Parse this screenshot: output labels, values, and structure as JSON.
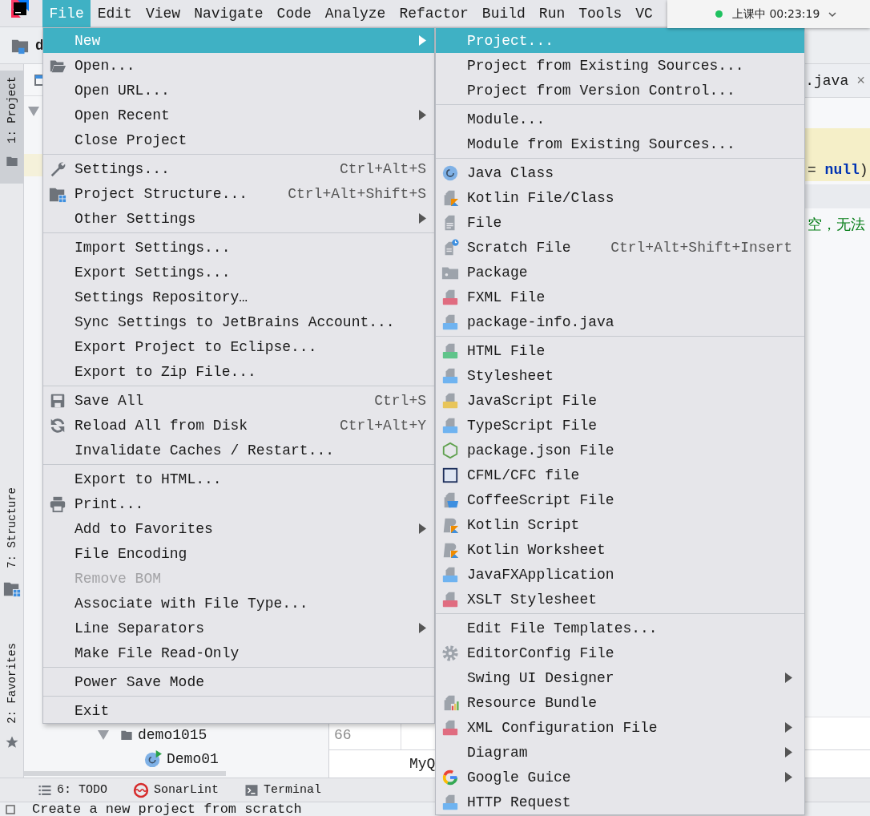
{
  "menubar": {
    "items": [
      {
        "label": "File",
        "selected": true
      },
      {
        "label": "Edit",
        "selected": false
      },
      {
        "label": "View",
        "selected": false
      },
      {
        "label": "Navigate",
        "selected": false
      },
      {
        "label": "Code",
        "selected": false
      },
      {
        "label": "Analyze",
        "selected": false
      },
      {
        "label": "Refactor",
        "selected": false
      },
      {
        "label": "Build",
        "selected": false
      },
      {
        "label": "Run",
        "selected": false
      },
      {
        "label": "Tools",
        "selected": false
      },
      {
        "label": "VC",
        "selected": false
      }
    ]
  },
  "session_timer": {
    "text": "上课中 00:23:19"
  },
  "toolbar": {
    "project_name": "d"
  },
  "tool_strip": {
    "tabs": [
      {
        "label": "1: Project",
        "kind": "folder",
        "selected": true
      },
      {
        "label": "7: Structure",
        "kind": "structure",
        "selected": false
      },
      {
        "label": "2: Favorites",
        "kind": "star",
        "selected": false
      }
    ]
  },
  "project_tree": {
    "rows": [
      {
        "label": "demo1015",
        "kind": "folder",
        "expanded": true,
        "children": [
          {
            "label": "Demo01",
            "kind": "runnable"
          }
        ]
      }
    ]
  },
  "editor": {
    "tab": {
      "label": ".java",
      "close": "×"
    },
    "code_lines": [
      {
        "text": "= **null**)",
        "kind": "code",
        "highlighted": true
      },
      {
        "text": "空，无法",
        "kind": "string",
        "highlighted": false
      }
    ],
    "gutter_number": "66",
    "bottom_panel": "MyQ"
  },
  "file_menu": {
    "sections": [
      [
        {
          "label": "New",
          "kind": "plain",
          "has_submenu": true,
          "selected": true,
          "disabled": false
        },
        {
          "label": "Open...",
          "kind": "open",
          "has_submenu": false,
          "selected": false,
          "disabled": false
        },
        {
          "label": "Open URL...",
          "kind": "plain",
          "has_submenu": false,
          "selected": false,
          "disabled": false
        },
        {
          "label": "Open Recent",
          "kind": "plain",
          "has_submenu": true,
          "selected": false,
          "disabled": false
        },
        {
          "label": "Close Project",
          "kind": "plain",
          "has_submenu": false,
          "selected": false,
          "disabled": false
        }
      ],
      [
        {
          "label": "Settings...",
          "kind": "wrench",
          "shortcut": "Ctrl+Alt+S",
          "has_submenu": false,
          "selected": false,
          "disabled": false
        },
        {
          "label": "Project Structure...",
          "kind": "structure",
          "shortcut": "Ctrl+Alt+Shift+S",
          "has_submenu": false,
          "selected": false,
          "disabled": false
        },
        {
          "label": "Other Settings",
          "kind": "plain",
          "has_submenu": true,
          "selected": false,
          "disabled": false
        }
      ],
      [
        {
          "label": "Import Settings...",
          "kind": "plain",
          "has_submenu": false,
          "selected": false,
          "disabled": false
        },
        {
          "label": "Export Settings...",
          "kind": "plain",
          "has_submenu": false,
          "selected": false,
          "disabled": false
        },
        {
          "label": "Settings Repository…",
          "kind": "plain",
          "has_submenu": false,
          "selected": false,
          "disabled": false
        },
        {
          "label": "Sync Settings to JetBrains Account...",
          "kind": "plain",
          "has_submenu": false,
          "selected": false,
          "disabled": false
        },
        {
          "label": "Export Project to Eclipse...",
          "kind": "plain",
          "has_submenu": false,
          "selected": false,
          "disabled": false
        },
        {
          "label": "Export to Zip File...",
          "kind": "plain",
          "has_submenu": false,
          "selected": false,
          "disabled": false
        }
      ],
      [
        {
          "label": "Save All",
          "kind": "save",
          "shortcut": "Ctrl+S",
          "has_submenu": false,
          "selected": false,
          "disabled": false
        },
        {
          "label": "Reload All from Disk",
          "kind": "reload",
          "shortcut": "Ctrl+Alt+Y",
          "has_submenu": false,
          "selected": false,
          "disabled": false
        },
        {
          "label": "Invalidate Caches / Restart...",
          "kind": "plain",
          "has_submenu": false,
          "selected": false,
          "disabled": false
        }
      ],
      [
        {
          "label": "Export to HTML...",
          "kind": "plain",
          "has_submenu": false,
          "selected": false,
          "disabled": false
        },
        {
          "label": "Print...",
          "kind": "printer",
          "has_submenu": false,
          "selected": false,
          "disabled": false
        },
        {
          "label": "Add to Favorites",
          "kind": "plain",
          "has_submenu": true,
          "selected": false,
          "disabled": false
        },
        {
          "label": "File Encoding",
          "kind": "plain",
          "has_submenu": false,
          "selected": false,
          "disabled": false
        },
        {
          "label": "Remove BOM",
          "kind": "plain",
          "has_submenu": false,
          "selected": false,
          "disabled": true
        },
        {
          "label": "Associate with File Type...",
          "kind": "plain",
          "has_submenu": false,
          "selected": false,
          "disabled": false
        },
        {
          "label": "Line Separators",
          "kind": "plain",
          "has_submenu": true,
          "selected": false,
          "disabled": false
        },
        {
          "label": "Make File Read-Only",
          "kind": "plain",
          "has_submenu": false,
          "selected": false,
          "disabled": false
        }
      ],
      [
        {
          "label": "Power Save Mode",
          "kind": "plain",
          "has_submenu": false,
          "selected": false,
          "disabled": false
        }
      ],
      [
        {
          "label": "Exit",
          "kind": "plain",
          "has_submenu": false,
          "selected": false,
          "disabled": false
        }
      ]
    ]
  },
  "new_submenu": {
    "sections": [
      [
        {
          "label": "Project...",
          "kind": "plain",
          "has_submenu": false,
          "selected": true
        },
        {
          "label": "Project from Existing Sources...",
          "kind": "plain",
          "has_submenu": false,
          "selected": false
        },
        {
          "label": "Project from Version Control...",
          "kind": "plain",
          "has_submenu": false,
          "selected": false
        }
      ],
      [
        {
          "label": "Module...",
          "kind": "plain",
          "has_submenu": false,
          "selected": false
        },
        {
          "label": "Module from Existing Sources...",
          "kind": "plain",
          "has_submenu": false,
          "selected": false
        }
      ],
      [
        {
          "label": "Java Class",
          "kind": "class",
          "has_submenu": false,
          "selected": false
        },
        {
          "label": "Kotlin File/Class",
          "kind": "kotlin",
          "has_submenu": false,
          "selected": false
        },
        {
          "label": "File",
          "kind": "file",
          "has_submenu": false,
          "selected": false
        },
        {
          "label": "Scratch File",
          "kind": "scratch",
          "shortcut": "Ctrl+Alt+Shift+Insert",
          "has_submenu": false,
          "selected": false
        },
        {
          "label": "Package",
          "kind": "package",
          "has_submenu": false,
          "selected": false
        },
        {
          "label": "FXML File",
          "kind": "xml",
          "has_submenu": false,
          "selected": false
        },
        {
          "label": "package-info.java",
          "kind": "javafile",
          "has_submenu": false,
          "selected": false
        }
      ],
      [
        {
          "label": "HTML File",
          "kind": "html",
          "has_submenu": false,
          "selected": false
        },
        {
          "label": "Stylesheet",
          "kind": "css",
          "has_submenu": false,
          "selected": false
        },
        {
          "label": "JavaScript File",
          "kind": "js",
          "has_submenu": false,
          "selected": false
        },
        {
          "label": "TypeScript File",
          "kind": "ts",
          "has_submenu": false,
          "selected": false
        },
        {
          "label": "package.json File",
          "kind": "hexagon",
          "has_submenu": false,
          "selected": false
        },
        {
          "label": "CFML/CFC file",
          "kind": "square",
          "has_submenu": false,
          "selected": false
        },
        {
          "label": "CoffeeScript File",
          "kind": "cup",
          "has_submenu": false,
          "selected": false
        },
        {
          "label": "Kotlin Script",
          "kind": "script",
          "has_submenu": false,
          "selected": false
        },
        {
          "label": "Kotlin Worksheet",
          "kind": "script",
          "has_submenu": false,
          "selected": false
        },
        {
          "label": "JavaFXApplication",
          "kind": "javafile",
          "has_submenu": false,
          "selected": false
        },
        {
          "label": "XSLT Stylesheet",
          "kind": "xml",
          "has_submenu": false,
          "selected": false
        }
      ],
      [
        {
          "label": "Edit File Templates...",
          "kind": "plain",
          "has_submenu": false,
          "selected": false
        },
        {
          "label": "EditorConfig File",
          "kind": "gear",
          "has_submenu": false,
          "selected": false
        },
        {
          "label": "Swing UI Designer",
          "kind": "plain",
          "has_submenu": true,
          "selected": false
        },
        {
          "label": "Resource Bundle",
          "kind": "bundle",
          "has_submenu": false,
          "selected": false
        },
        {
          "label": "XML Configuration File",
          "kind": "xml",
          "has_submenu": true,
          "selected": false
        },
        {
          "label": "Diagram",
          "kind": "plain",
          "has_submenu": true,
          "selected": false
        },
        {
          "label": "Google Guice",
          "kind": "ring",
          "has_submenu": true,
          "selected": false
        },
        {
          "label": "HTTP Request",
          "kind": "api",
          "has_submenu": false,
          "selected": false
        }
      ]
    ]
  },
  "tool_windows": [
    {
      "label": "6: TODO",
      "kind": "list"
    },
    {
      "label": "SonarLint",
      "kind": "sonar"
    },
    {
      "label": "Terminal",
      "kind": "terminal"
    }
  ],
  "status_bar": {
    "message": "Create a new project from scratch"
  }
}
